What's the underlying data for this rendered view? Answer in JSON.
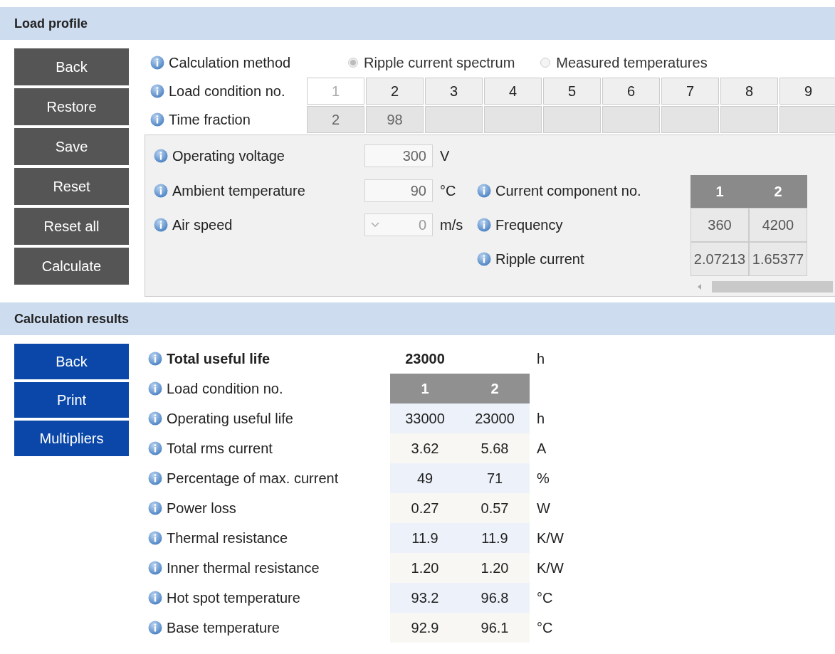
{
  "load_profile": {
    "title": "Load profile",
    "buttons": [
      "Back",
      "Restore",
      "Save",
      "Reset",
      "Reset all",
      "Calculate"
    ],
    "calculation_method": {
      "label": "Calculation method",
      "options": [
        {
          "label": "Ripple current spectrum",
          "selected": true
        },
        {
          "label": "Measured temperatures",
          "selected": false
        }
      ]
    },
    "load_condition": {
      "label": "Load condition no.",
      "cells": [
        {
          "label": "1",
          "selected": true
        },
        {
          "label": "2",
          "selected": false
        },
        {
          "label": "3",
          "selected": false
        },
        {
          "label": "4",
          "selected": false
        },
        {
          "label": "5",
          "selected": false
        },
        {
          "label": "6",
          "selected": false
        },
        {
          "label": "7",
          "selected": false
        },
        {
          "label": "8",
          "selected": false
        },
        {
          "label": "9",
          "selected": false
        }
      ]
    },
    "time_fraction": {
      "label": "Time fraction",
      "values": [
        "2",
        "98"
      ]
    },
    "parameters": [
      {
        "kind": "input",
        "label": "Operating voltage",
        "value": "300",
        "unit": "V"
      },
      {
        "kind": "input",
        "label": "Ambient temperature",
        "value": "90",
        "unit": "°C"
      },
      {
        "kind": "select",
        "label": "Air speed",
        "value": "0",
        "unit": "m/s"
      }
    ],
    "components": {
      "label": "Current component no.",
      "columns": [
        "1",
        "2"
      ],
      "rows": [
        {
          "label": "Frequency",
          "values": [
            "360",
            "4200"
          ]
        },
        {
          "label": "Ripple current",
          "values": [
            "2.07213",
            "1.65377"
          ]
        }
      ]
    }
  },
  "results": {
    "title": "Calculation results",
    "buttons": [
      "Back",
      "Print",
      "Multipliers"
    ],
    "total": {
      "label": "Total useful life",
      "value": "23000",
      "unit": "h"
    },
    "table": {
      "label": "Load condition no.",
      "columns": [
        "1",
        "2"
      ],
      "rows": [
        {
          "label": "Operating useful life",
          "values": [
            "33000",
            "23000"
          ],
          "unit": "h"
        },
        {
          "label": "Total rms current",
          "values": [
            "3.62",
            "5.68"
          ],
          "unit": "A"
        },
        {
          "label": "Percentage of max. current",
          "values": [
            "49",
            "71"
          ],
          "unit": "%"
        },
        {
          "label": "Power loss",
          "values": [
            "0.27",
            "0.57"
          ],
          "unit": "W"
        },
        {
          "label": "Thermal resistance",
          "values": [
            "11.9",
            "11.9"
          ],
          "unit": "K/W"
        },
        {
          "label": "Inner thermal resistance",
          "values": [
            "1.20",
            "1.20"
          ],
          "unit": "K/W"
        },
        {
          "label": "Hot spot temperature",
          "values": [
            "93.2",
            "96.8"
          ],
          "unit": "°C"
        },
        {
          "label": "Base temperature",
          "values": [
            "92.9",
            "96.1"
          ],
          "unit": "°C"
        }
      ]
    }
  }
}
